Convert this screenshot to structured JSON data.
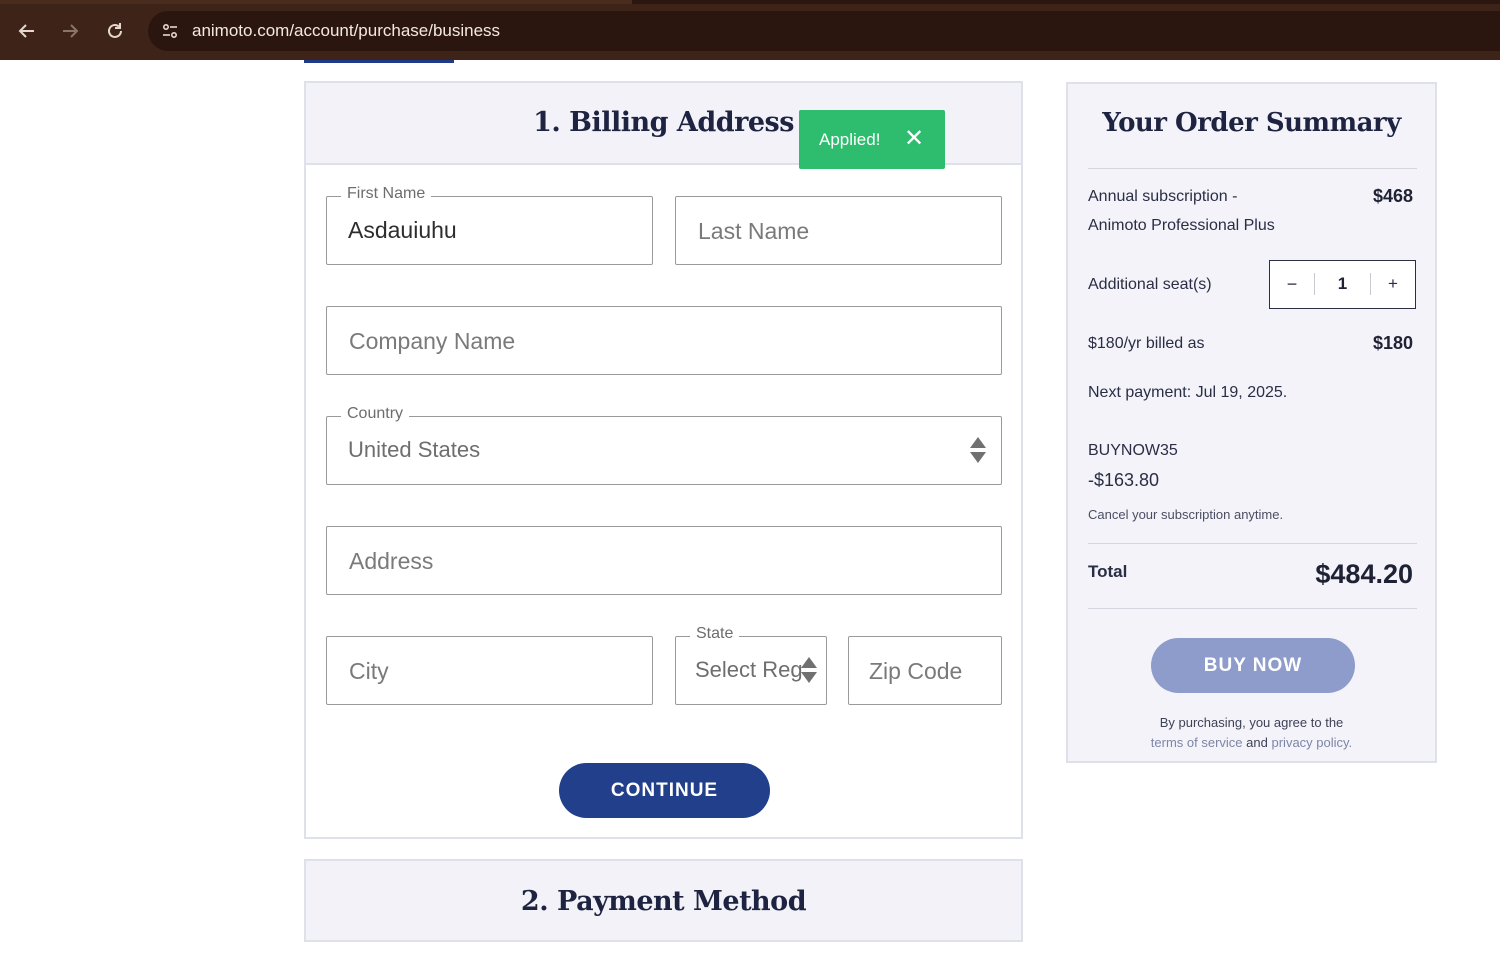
{
  "browser": {
    "url": "animoto.com/account/purchase/business"
  },
  "toast": {
    "text": "Applied!",
    "close_glyph": "✕"
  },
  "billing": {
    "title": "1. Billing Address",
    "first_name": {
      "label": "First Name",
      "value": "Asdauiuhu"
    },
    "last_name": {
      "placeholder": "Last Name"
    },
    "company": {
      "placeholder": "Company Name"
    },
    "country": {
      "label": "Country",
      "value": "United States"
    },
    "address": {
      "placeholder": "Address"
    },
    "city": {
      "placeholder": "City"
    },
    "state": {
      "label": "State",
      "value": "Select Reg"
    },
    "zip": {
      "placeholder": "Zip Code"
    },
    "continue_label": "CONTINUE"
  },
  "payment": {
    "title": "2. Payment Method"
  },
  "summary": {
    "title": "Your Order Summary",
    "subscription_line1": "Annual subscription -",
    "subscription_line2": "Animoto Professional Plus",
    "subscription_amount": "$468",
    "seats_label": "Additional seat(s)",
    "seats_minus": "−",
    "seats_qty": "1",
    "seats_plus": "+",
    "billed_label": "$180/yr billed as",
    "billed_amount": "$180",
    "next_payment": "Next payment: Jul 19, 2025.",
    "promo_code": "BUYNOW35",
    "promo_discount": "-$163.80",
    "cancel_note": "Cancel your subscription anytime.",
    "total_label": "Total",
    "total_amount": "$484.20",
    "buy_label": "BUY NOW",
    "legal_line1": "By purchasing, you agree to the",
    "legal_terms": "terms of service",
    "legal_and": "and",
    "legal_privacy": "privacy policy."
  },
  "colors": {
    "brand_navy": "#213f8a",
    "toast_green": "#2ebd6e",
    "buy_disabled": "#8d9ccb",
    "browser_chrome": "#3e2418"
  }
}
